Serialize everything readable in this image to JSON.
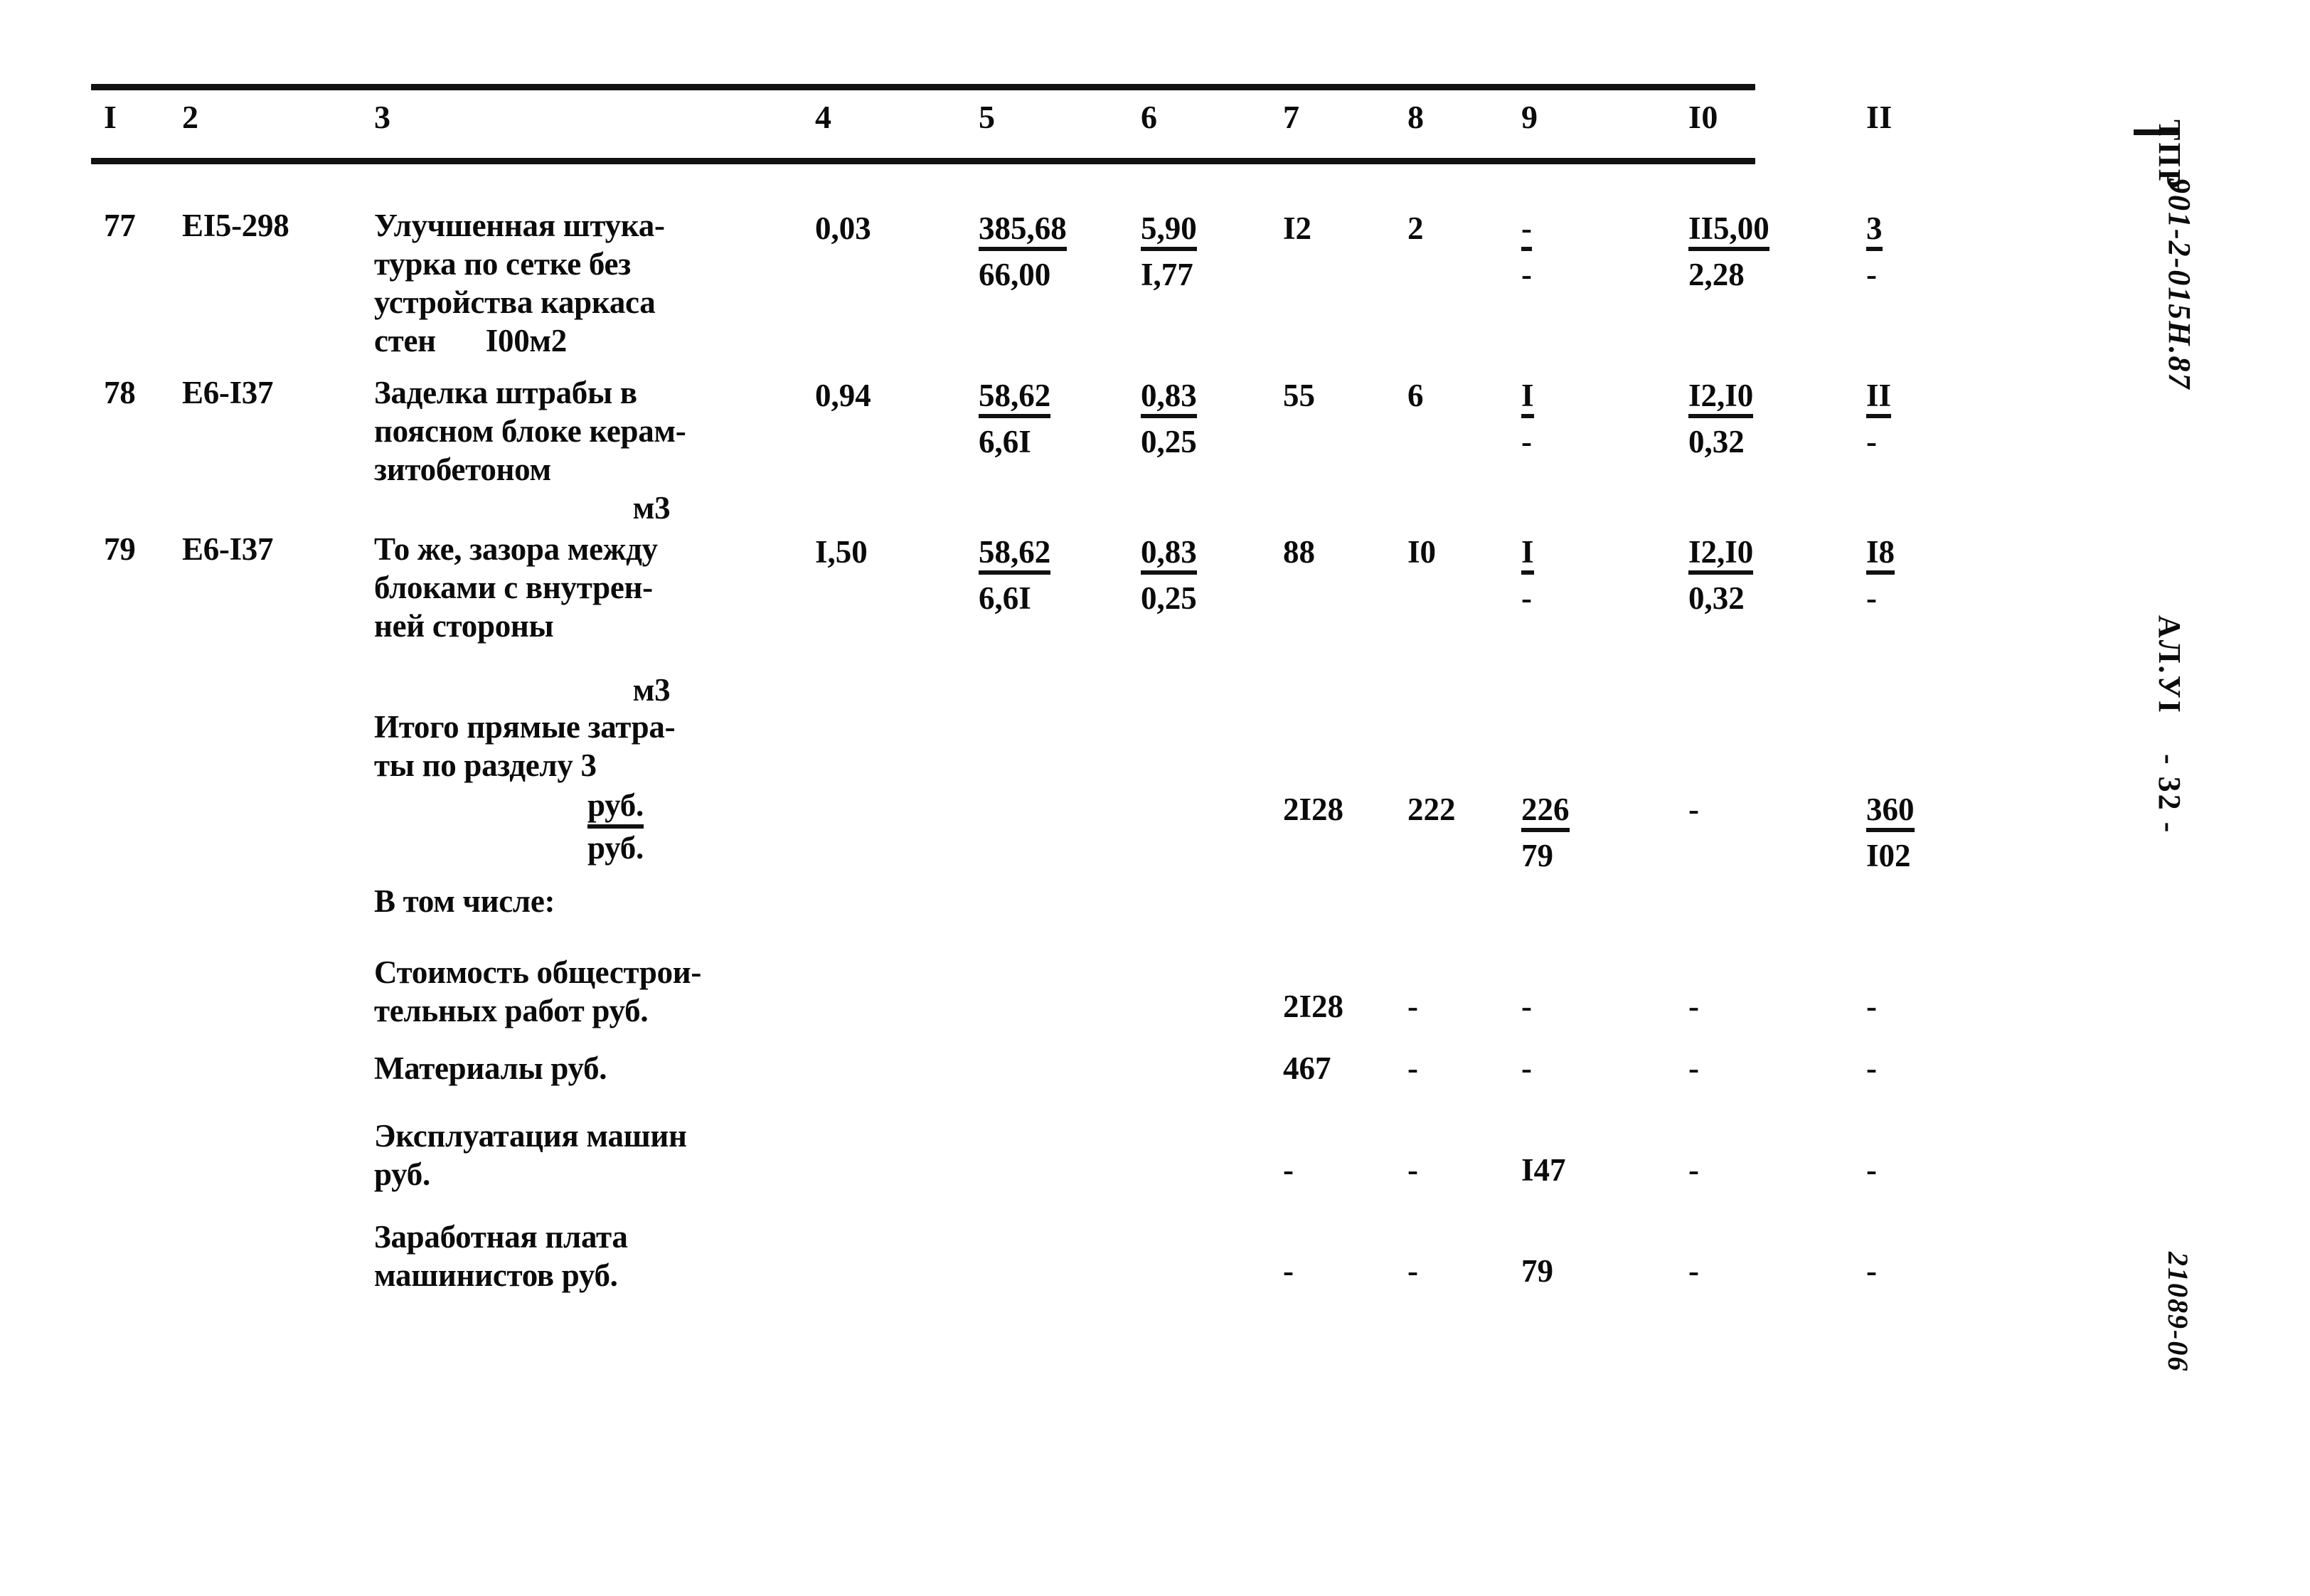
{
  "document": {
    "side_code": "901-2-015Н.87",
    "side_prefix": "ТПР",
    "side_album": "АЛ.УI",
    "side_page": "- 32 -",
    "side_stamp": "21089-06"
  },
  "table": {
    "column_headers": [
      "I",
      "2",
      "3",
      "4",
      "5",
      "6",
      "7",
      "8",
      "9",
      "I0",
      "II"
    ],
    "rows": [
      {
        "kind": "item",
        "c1": "77",
        "c2": "ЕI5-298",
        "c3": "Улучшенная штука-\nтурка по сетке без\nустройства каркаса\nстен",
        "c3_unit": "I00м2",
        "c4": "0,03",
        "c5_top": "385,68",
        "c5_bot": "66,00",
        "c6_top": "5,90",
        "c6_bot": "I,77",
        "c7": "I2",
        "c8": "2",
        "c9_top": "-",
        "c9_bot": "-",
        "c10_top": "II5,00",
        "c10_bot": "2,28",
        "c11_top": "3",
        "c11_bot": "-"
      },
      {
        "kind": "item",
        "c1": "78",
        "c2": "Е6-I37",
        "c3": "Заделка штрабы в\nпоясном блоке керам-\nзитобетоном",
        "c3_unit": "м3",
        "c4": "0,94",
        "c5_top": "58,62",
        "c5_bot": "6,6I",
        "c6_top": "0,83",
        "c6_bot": "0,25",
        "c7": "55",
        "c8": "6",
        "c9_top": "I",
        "c9_bot": "-",
        "c10_top": "I2,I0",
        "c10_bot": "0,32",
        "c11_top": "II",
        "c11_bot": "-"
      },
      {
        "kind": "item",
        "c1": "79",
        "c2": "Е6-I37",
        "c3": "То же, зазора между\nблоками с внутрен-\nней стороны",
        "c3_unit": "м3",
        "c4": "I,50",
        "c5_top": "58,62",
        "c5_bot": "6,6I",
        "c6_top": "0,83",
        "c6_bot": "0,25",
        "c7": "88",
        "c8": "I0",
        "c9_top": "I",
        "c9_bot": "-",
        "c10_top": "I2,I0",
        "c10_bot": "0,32",
        "c11_top": "I8",
        "c11_bot": "-"
      },
      {
        "kind": "total",
        "c3": "Итого прямые затра-\nты по разделу 3",
        "c3_unit_top": "руб.",
        "c3_unit_bot": "руб.",
        "c7": "2I28",
        "c8": "222",
        "c9_top": "226",
        "c9_bot": "79",
        "c10": "-",
        "c11_top": "360",
        "c11_bot": "I02"
      },
      {
        "kind": "plain",
        "c3": "В том числе:"
      },
      {
        "kind": "sub",
        "c3": "Стоимость общестрои-\nтельных работ  руб.",
        "c7": "2I28",
        "c8": "-",
        "c9": "-",
        "c10": "-",
        "c11": "-"
      },
      {
        "kind": "sub",
        "c3": "Материалы    руб.",
        "c7": "467",
        "c8": "-",
        "c9": "-",
        "c10": "-",
        "c11": "-"
      },
      {
        "kind": "sub",
        "c3": "Эксплуатация машин\n          руб.",
        "c7": "-",
        "c8": "-",
        "c9": "I47",
        "c10": "-",
        "c11": "-"
      },
      {
        "kind": "sub",
        "c3": "Заработная плата\nмашинистов    руб.",
        "c7": "-",
        "c8": "-",
        "c9": "79",
        "c10": "-",
        "c11": "-"
      }
    ]
  }
}
